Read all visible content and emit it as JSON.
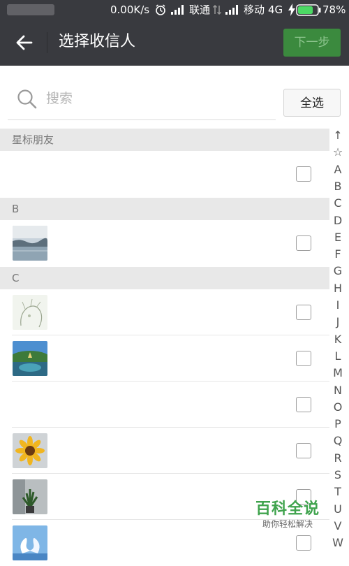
{
  "status_bar": {
    "speed": "0.00K/s",
    "carrier1": "联通",
    "carrier2": "移动",
    "network": "4G",
    "battery": "78%",
    "battery_level": 0.78,
    "battery_color": "#4cd964"
  },
  "toolbar": {
    "title": "选择收信人",
    "next_label": "下一步",
    "accent": "#3b8a3e"
  },
  "search": {
    "placeholder": "搜索",
    "select_all_label": "全选"
  },
  "sections": [
    {
      "header": "星标朋友",
      "contacts": [
        {
          "avatar": "none"
        }
      ]
    },
    {
      "header": "B",
      "contacts": [
        {
          "avatar": "lake-landscape"
        }
      ]
    },
    {
      "header": "C",
      "contacts": [
        {
          "avatar": "anime-sketch"
        },
        {
          "avatar": "wide-angle-lake"
        },
        {
          "avatar": "none"
        },
        {
          "avatar": "sunflower"
        },
        {
          "avatar": "potted-plant"
        },
        {
          "avatar": "swan-pair"
        }
      ]
    }
  ],
  "index_bar": [
    "↑",
    "☆",
    "A",
    "B",
    "C",
    "D",
    "E",
    "F",
    "G",
    "H",
    "I",
    "J",
    "K",
    "L",
    "M",
    "N",
    "O",
    "P",
    "Q",
    "R",
    "S",
    "T",
    "U",
    "V",
    "W"
  ],
  "watermark": {
    "title": "百科全说",
    "subtitle": "助你轻松解决"
  }
}
